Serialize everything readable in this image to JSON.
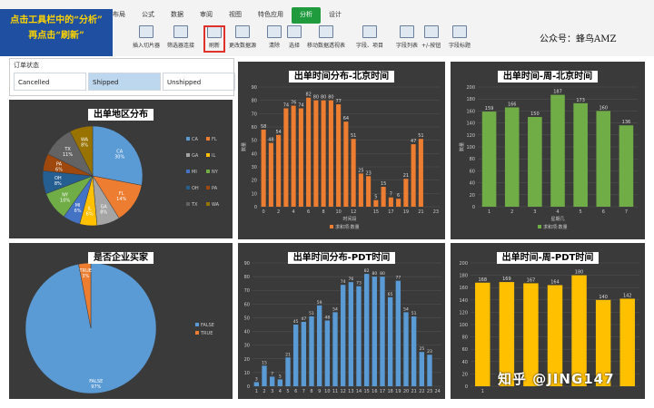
{
  "ribbon": {
    "tabs": [
      "布局",
      "公式",
      "数据",
      "审阅",
      "视图",
      "特色应用",
      "分析",
      "设计"
    ],
    "active_tab_index": 6,
    "tools": [
      "插入切片器",
      "筛选器连接",
      "刷新",
      "更改数据源",
      "清除",
      "选择",
      "移动数据透视表",
      "字段、项目",
      "字段列表",
      "+/-按钮",
      "字段标题"
    ]
  },
  "note": {
    "line1": "点击工具栏中的“分析”",
    "line2": "再点击“刷新”"
  },
  "account": "公众号：蜂鸟AMZ",
  "slicer": {
    "title": "订单状态",
    "items": [
      "Cancelled",
      "Shipped",
      "Unshipped"
    ],
    "selected_index": 1
  },
  "watermark": "知乎 @JING147",
  "colors": {
    "panel_bg": "#3a3a3a",
    "orange": "#ed7d31",
    "green": "#70ad47",
    "blue": "#5b9bd5",
    "gold": "#ffc000"
  },
  "chart_data": [
    {
      "type": "pie",
      "title": "出单地区分布",
      "slices": [
        {
          "label": "CA",
          "value": 30,
          "color": "#5b9bd5"
        },
        {
          "label": "FL",
          "value": 14,
          "color": "#ed7d31"
        },
        {
          "label": "GA",
          "value": 8,
          "color": "#a5a5a5"
        },
        {
          "label": "IL",
          "value": 6,
          "color": "#ffc000"
        },
        {
          "label": "MI",
          "value": 6,
          "color": "#4472c4"
        },
        {
          "label": "NY",
          "value": 10,
          "color": "#70ad47"
        },
        {
          "label": "OH",
          "value": 8,
          "color": "#255e91"
        },
        {
          "label": "PA",
          "value": 6,
          "color": "#9e480e"
        },
        {
          "label": "TX",
          "value": 11,
          "color": "#636363"
        },
        {
          "label": "WA",
          "value": 8,
          "color": "#997300"
        }
      ],
      "slice_labels": [
        {
          "name": "CA",
          "pct": "30%"
        },
        {
          "name": "FL",
          "pct": "14%"
        },
        {
          "name": "GA",
          "pct": "8%"
        },
        {
          "name": "IL",
          "pct": "6%"
        },
        {
          "name": "MI",
          "pct": "6%"
        },
        {
          "name": "NY",
          "pct": "10%"
        },
        {
          "name": "OH",
          "pct": "8%"
        },
        {
          "name": "PA",
          "pct": "6%"
        },
        {
          "name": "TX",
          "pct": "11%"
        },
        {
          "name": "WA",
          "pct": "8%"
        }
      ],
      "legend": [
        "CA",
        "FL",
        "GA",
        "IL",
        "MI",
        "NY",
        "OH",
        "PA",
        "TX",
        "WA"
      ],
      "legend_position": "right"
    },
    {
      "type": "bar",
      "title": "出单时间分布-北京时间",
      "categories": [
        "0",
        "1",
        "2",
        "3",
        "4",
        "5",
        "6",
        "7",
        "8",
        "9",
        "10",
        "11",
        "12",
        "13",
        "14",
        "15",
        "16",
        "17",
        "18",
        "19",
        "20",
        "21",
        "22",
        "23"
      ],
      "values": [
        58,
        48,
        54,
        74,
        76,
        74,
        82,
        80,
        80,
        80,
        77,
        64,
        51,
        25,
        23,
        5,
        15,
        7,
        6,
        21,
        47,
        51,
        null,
        null
      ],
      "x_tick_labels": [
        "0",
        "2",
        "4",
        "6",
        "8",
        "10",
        "12",
        "15",
        "17",
        "19",
        "21",
        "23"
      ],
      "ylim": [
        0,
        90
      ],
      "y_ticks": [
        "0",
        "10",
        "20",
        "30",
        "40",
        "50",
        "60",
        "70",
        "80",
        "90"
      ],
      "xlabel": "时间段",
      "ylabel": "数量",
      "legend": "求和项:数量",
      "color": "#ed7d31"
    },
    {
      "type": "bar",
      "title": "出单时间-周-北京时间",
      "categories": [
        "1",
        "2",
        "3",
        "4",
        "5",
        "6",
        "7"
      ],
      "values": [
        159,
        166,
        150,
        187,
        173,
        160,
        136
      ],
      "ylim": [
        0,
        200
      ],
      "y_ticks": [
        "0",
        "20",
        "40",
        "60",
        "80",
        "100",
        "120",
        "140",
        "160",
        "180",
        "200"
      ],
      "xlabel": "星期几",
      "ylabel": "数量",
      "legend": "求和项:数量",
      "color": "#70ad47"
    },
    {
      "type": "pie",
      "title": "是否企业买家",
      "slices": [
        {
          "label": "FALSE",
          "value": 97,
          "color": "#5b9bd5"
        },
        {
          "label": "TRUE",
          "value": 3,
          "color": "#ed7d31"
        }
      ],
      "slice_labels": [
        {
          "name": "FALSE",
          "pct": "97%"
        },
        {
          "name": "TRUE",
          "pct": "3%"
        }
      ],
      "legend": [
        "FALSE",
        "TRUE"
      ],
      "legend_position": "right"
    },
    {
      "type": "bar",
      "title": "出单时间分布-PDT时间",
      "categories": [
        "1",
        "2",
        "3",
        "4",
        "5",
        "6",
        "7",
        "8",
        "9",
        "10",
        "11",
        "12",
        "13",
        "14",
        "15",
        "16",
        "17",
        "18",
        "19",
        "20",
        "21",
        "22",
        "23",
        "24"
      ],
      "values": [
        3,
        15,
        7,
        5,
        21,
        45,
        47,
        51,
        59,
        48,
        54,
        74,
        76,
        73,
        82,
        80,
        80,
        65,
        77,
        54,
        51,
        25,
        23,
        null
      ],
      "ylim": [
        0,
        90
      ],
      "y_ticks": [
        "0",
        "10",
        "20",
        "30",
        "40",
        "50",
        "60",
        "70",
        "80",
        "90"
      ],
      "color": "#5b9bd5"
    },
    {
      "type": "bar",
      "title": "出单时间-周-PDT时间",
      "categories": [
        "1",
        "2",
        "3",
        "4",
        "5",
        "6",
        "7"
      ],
      "values": [
        168,
        169,
        167,
        164,
        180,
        140,
        142
      ],
      "ylim": [
        0,
        200
      ],
      "y_ticks": [
        "0",
        "20",
        "40",
        "60",
        "80",
        "100",
        "120",
        "140",
        "160",
        "180",
        "200"
      ],
      "x_tick_labels": [
        "1"
      ],
      "color": "#ffc000"
    }
  ]
}
